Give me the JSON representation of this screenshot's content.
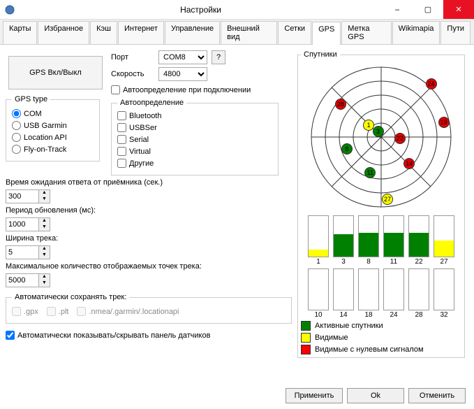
{
  "window": {
    "title": "Настройки",
    "min": "–",
    "max": "▢",
    "close": "✕"
  },
  "tabs": [
    "Карты",
    "Избранное",
    "Кэш",
    "Интернет",
    "Управление",
    "Внешний вид",
    "Сетки",
    "GPS",
    "Метка GPS",
    "Wikimapia",
    "Пути"
  ],
  "active_tab": 7,
  "gps_button": "GPS Вкл/Выкл",
  "gps_type": {
    "legend": "GPS type",
    "options": [
      "COM",
      "USB Garmin",
      "Location API",
      "Fly-on-Track"
    ],
    "selected": 0
  },
  "port": {
    "label": "Порт",
    "value": "COM8",
    "help": "?"
  },
  "speed": {
    "label": "Скорость",
    "value": "4800"
  },
  "autoconnect": {
    "label": "Автоопределение при подключении",
    "checked": false
  },
  "autodetect": {
    "legend": "Автоопределение",
    "options": [
      "Bluetooth",
      "USBSer",
      "Serial",
      "Virtual",
      "Другие"
    ]
  },
  "wait": {
    "label": "Время ожидания ответа от приёмника (сек.)",
    "value": "300"
  },
  "period": {
    "label": "Период обновления (мс):",
    "value": "1000"
  },
  "trackwidth": {
    "label": "Ширина трека:",
    "value": "5"
  },
  "maxpoints": {
    "label": "Максимальное количество отображаемых точек трека:",
    "value": "5000"
  },
  "autosave": {
    "legend": "Автоматически сохранять трек:",
    "formats": [
      ".gpx",
      ".plt",
      ".nmea/.garmin/.locationapi"
    ]
  },
  "autoshow": {
    "label": "Автоматически показывать/скрывать панель датчиков",
    "checked": true
  },
  "satellites": {
    "legend": "Спутники"
  },
  "chart_data": {
    "type": "radar+bar",
    "radar_satellites": [
      {
        "id": 24,
        "status": "red",
        "x": 0.82,
        "y": 0.14
      },
      {
        "id": 28,
        "status": "red",
        "x": 0.24,
        "y": 0.28
      },
      {
        "id": 1,
        "status": "yellow",
        "x": 0.42,
        "y": 0.42
      },
      {
        "id": 3,
        "status": "green",
        "x": 0.48,
        "y": 0.46
      },
      {
        "id": 19,
        "status": "red",
        "x": 0.9,
        "y": 0.4
      },
      {
        "id": 22,
        "status": "red",
        "x": 0.62,
        "y": 0.51
      },
      {
        "id": 8,
        "status": "green",
        "x": 0.28,
        "y": 0.58
      },
      {
        "id": 11,
        "status": "green",
        "x": 0.43,
        "y": 0.74
      },
      {
        "id": 14,
        "status": "red",
        "x": 0.68,
        "y": 0.68
      },
      {
        "id": 27,
        "status": "yellow",
        "x": 0.54,
        "y": 0.92
      }
    ],
    "bars_top": [
      {
        "id": 1,
        "level": 0.18,
        "color": "yellow"
      },
      {
        "id": 3,
        "level": 0.55,
        "color": "green"
      },
      {
        "id": 8,
        "level": 0.58,
        "color": "green"
      },
      {
        "id": 11,
        "level": 0.58,
        "color": "green"
      },
      {
        "id": 22,
        "level": 0.58,
        "color": "green"
      },
      {
        "id": 27,
        "level": 0.4,
        "color": "yellow"
      }
    ],
    "bars_bottom": [
      {
        "id": 10,
        "level": 0,
        "color": "none"
      },
      {
        "id": 14,
        "level": 0,
        "color": "none"
      },
      {
        "id": 18,
        "level": 0,
        "color": "none"
      },
      {
        "id": 24,
        "level": 0,
        "color": "none"
      },
      {
        "id": 28,
        "level": 0,
        "color": "none"
      },
      {
        "id": 32,
        "level": 0,
        "color": "none"
      }
    ]
  },
  "legend": {
    "active": {
      "label": "Активные спутники",
      "color": "#008000"
    },
    "visible": {
      "label": "Видимые",
      "color": "#ffff00"
    },
    "zero": {
      "label": "Видимые с нулевым сигналом",
      "color": "#ff0000"
    }
  },
  "footer": {
    "apply": "Применить",
    "ok": "Ok",
    "cancel": "Отменить"
  }
}
